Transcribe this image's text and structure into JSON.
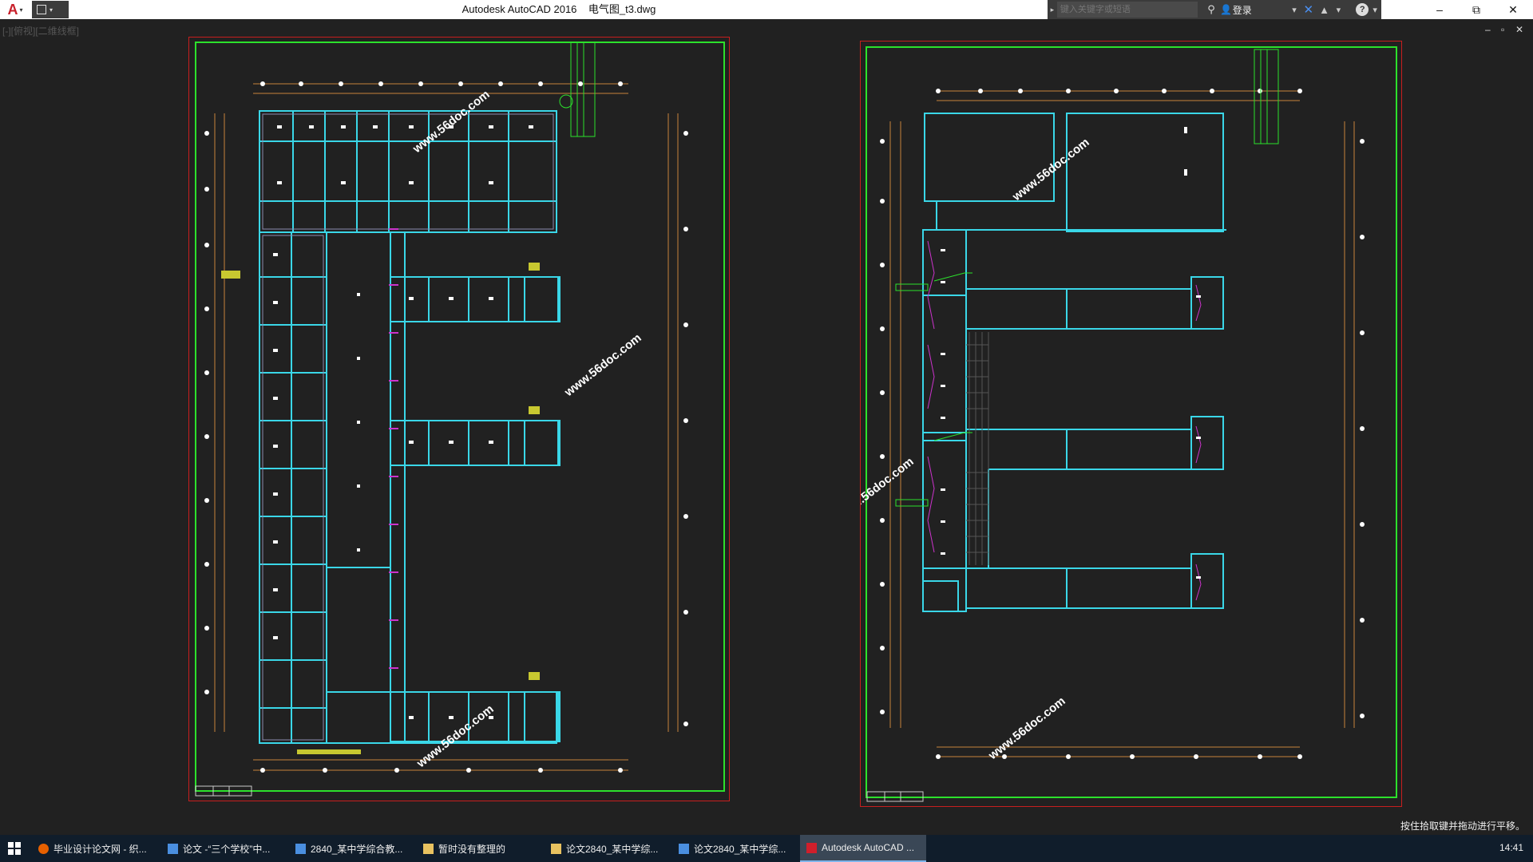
{
  "titlebar": {
    "title": "Autodesk AutoCAD 2016    电气图_t3.dwg",
    "search_placeholder": "键入关键字或短语",
    "login_label": "登录",
    "icons": [
      "autocad-logo-icon",
      "qat-icon",
      "binocular-icon",
      "user-icon",
      "x-exchange-icon",
      "a360-icon",
      "help-icon"
    ]
  },
  "window_controls": {
    "minimize": "–",
    "maximize": "⧉",
    "close": "✕"
  },
  "viewport": {
    "label": "[-][俯视][二维线框]",
    "controls": {
      "minimize": "–",
      "restore": "▫",
      "close": "✕"
    }
  },
  "drawing": {
    "watermark": "www.56doc.com",
    "colors": {
      "background": "#212121",
      "sheet_border": "#c71e1e",
      "frame": "#2ce12c",
      "walls": "#3ad7e8",
      "axis": "#c8823c",
      "markers": "#ffffff",
      "accent_magenta": "#cc33cc"
    }
  },
  "command_line": {
    "prompt": "按住拾取键并拖动进行平移。"
  },
  "taskbar": {
    "items": [
      {
        "label": "毕业设计论文网 - 织...",
        "icon": "firefox-icon",
        "color": "#e66000"
      },
      {
        "label": "论文 -“三个学校”中...",
        "icon": "word-doc-icon",
        "color": "#4a8fe0"
      },
      {
        "label": "2840_某中学综合教...",
        "icon": "word-doc-icon",
        "color": "#4a8fe0"
      },
      {
        "label": "暂时没有整理的",
        "icon": "folder-icon",
        "color": "#e8c260"
      },
      {
        "label": "论文2840_某中学综...",
        "icon": "folder-icon",
        "color": "#e8c260"
      },
      {
        "label": "论文2840_某中学综...",
        "icon": "word-doc-icon",
        "color": "#4a8fe0"
      },
      {
        "label": "Autodesk AutoCAD ...",
        "icon": "autocad-taskbar-icon",
        "color": "#d01f2b"
      }
    ],
    "clock": "14:41"
  }
}
